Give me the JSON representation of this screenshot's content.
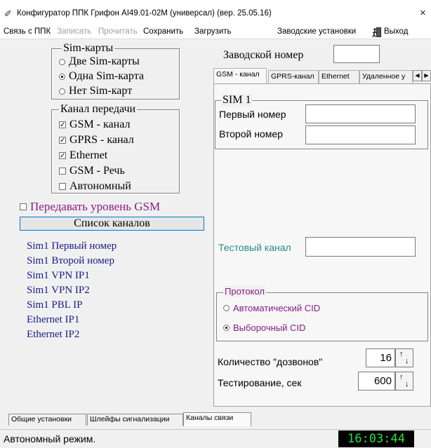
{
  "window": {
    "title": "Конфигуратор ППК Грифон AI49.01-02М (универсал) (вер. 25.05.16)",
    "close_glyph": "×"
  },
  "menu": {
    "items": [
      {
        "label": "Связь с ППК",
        "enabled": true
      },
      {
        "label": "Записать",
        "enabled": false
      },
      {
        "label": "Прочитать",
        "enabled": false
      },
      {
        "label": "Сохранить",
        "enabled": true
      },
      {
        "label": "Загрузить",
        "enabled": true
      },
      {
        "label": "Заводские установки",
        "enabled": true
      },
      {
        "label": "Выход",
        "enabled": true
      }
    ]
  },
  "sim_cards": {
    "title": "Sim-карты",
    "options": [
      {
        "label": "Две Sim-карты",
        "selected": false
      },
      {
        "label": "Одна Sim-карта",
        "selected": true
      },
      {
        "label": "Нет Sim-карт",
        "selected": false
      }
    ]
  },
  "transmission_channel": {
    "title": "Канал передачи",
    "options": [
      {
        "label": "GSM - канал",
        "checked": true
      },
      {
        "label": "GPRS - канал",
        "checked": true
      },
      {
        "label": "Ethernet",
        "checked": true
      },
      {
        "label": "GSM - Речь",
        "checked": false
      },
      {
        "label": "Автономный",
        "checked": false
      }
    ]
  },
  "gsm_level": {
    "label": "Передавать уровень GSM",
    "checked": false
  },
  "channel_list_button": "Список каналов",
  "channel_list": [
    "Sim1 Первый номер",
    "Sim1 Второй номер",
    "Sim1 VPN IP1",
    "Sim1 VPN IP2",
    "Sim1 PBL IP",
    "Ethernet IP1",
    "Ethernet IP2"
  ],
  "factory_number": {
    "label": "Заводской номер",
    "value": ""
  },
  "tabs": [
    {
      "label": "GSM - канал",
      "active": true
    },
    {
      "label": "GPRS-канал",
      "active": false
    },
    {
      "label": "Ethernet",
      "active": false
    },
    {
      "label": "Удаленное у",
      "active": false
    }
  ],
  "sim1": {
    "title": "SIM 1",
    "first_number_label": "Первый номер",
    "first_number_value": "",
    "second_number_label": "Второй номер",
    "second_number_value": ""
  },
  "test_channel": {
    "label": "Тестовый канал",
    "value": ""
  },
  "protocol": {
    "title": "Протокол",
    "options": [
      {
        "label": "Автоматический CID",
        "selected": false
      },
      {
        "label": "Выборочный CID",
        "selected": true
      }
    ]
  },
  "dial_count": {
    "label": "Количество \"дозвонов\"",
    "value": "16"
  },
  "testing": {
    "label": "Тестирование,  сек",
    "value": "600"
  },
  "bottom_tabs": [
    {
      "label": "Общие установки",
      "active": false
    },
    {
      "label": "Шлейфы сигнализации",
      "active": false
    },
    {
      "label": "Каналы связи",
      "active": true
    }
  ],
  "status": {
    "text": "Автономный режим.",
    "clock": "16:03:44"
  },
  "colors": {
    "channel_list": "#1a1a8a",
    "gsm_level": "#8a1a8a",
    "test_channel": "#2a8a8a",
    "clock_text": "#27e03a"
  }
}
